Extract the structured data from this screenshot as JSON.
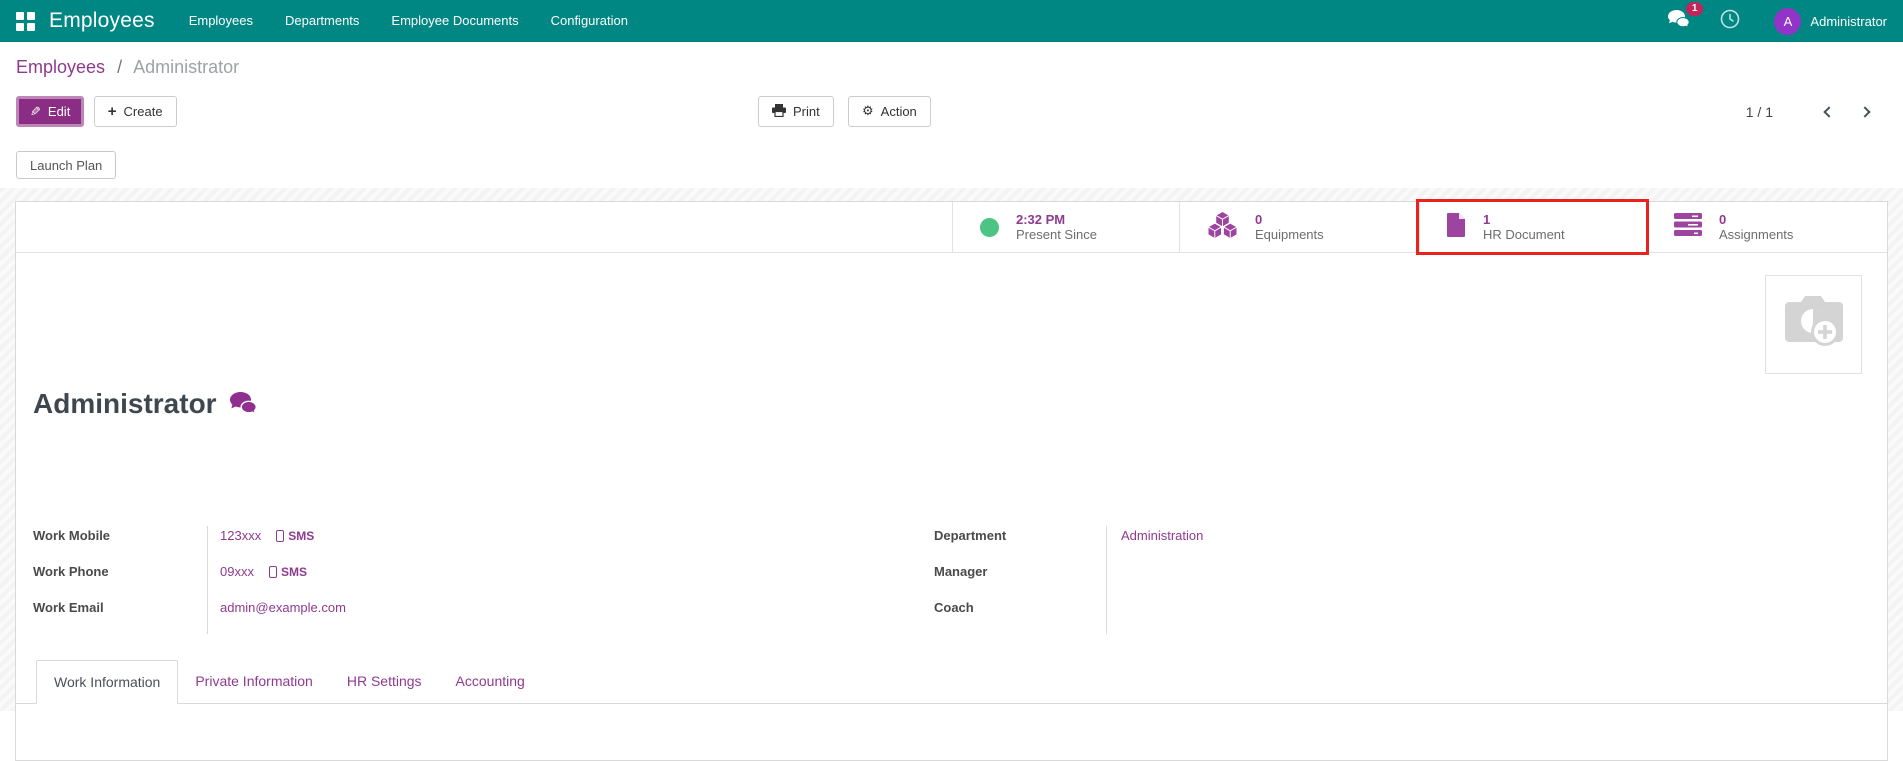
{
  "nav": {
    "brand": "Employees",
    "menu": [
      {
        "label": "Employees"
      },
      {
        "label": "Departments"
      },
      {
        "label": "Employee Documents"
      },
      {
        "label": "Configuration"
      }
    ],
    "messages_badge": "1",
    "user": {
      "initial": "A",
      "name": "Administrator"
    }
  },
  "breadcrumb": {
    "parent": "Employees",
    "separator": "/",
    "current": "Administrator"
  },
  "toolbar": {
    "edit": "Edit",
    "create": "Create",
    "print": "Print",
    "action": "Action",
    "pager": "1 / 1"
  },
  "buttons": {
    "launch_plan": "Launch Plan"
  },
  "stats": [
    {
      "value": "2:32 PM",
      "label": "Present Since",
      "icon": "presence-dot",
      "highlighted": false
    },
    {
      "value": "0",
      "label": "Equipments",
      "icon": "cubes",
      "highlighted": false
    },
    {
      "value": "1",
      "label": "HR Document",
      "icon": "file",
      "highlighted": true
    },
    {
      "value": "0",
      "label": "Assignments",
      "icon": "tasks",
      "highlighted": false
    }
  ],
  "employee": {
    "name": "Administrator",
    "left_fields": [
      {
        "label": "Work Mobile",
        "value": "123xxx",
        "action": "SMS"
      },
      {
        "label": "Work Phone",
        "value": "09xxx",
        "action": "SMS"
      },
      {
        "label": "Work Email",
        "value": "admin@example.com"
      }
    ],
    "right_fields": [
      {
        "label": "Department",
        "value": "Administration"
      },
      {
        "label": "Manager",
        "value": ""
      },
      {
        "label": "Coach",
        "value": ""
      }
    ]
  },
  "tabs": [
    {
      "label": "Work Information"
    },
    {
      "label": "Private Information"
    },
    {
      "label": "HR Settings"
    },
    {
      "label": "Accounting"
    }
  ],
  "colors": {
    "navbar_teal": "#008784",
    "accent_purple": "#8f3a8f",
    "primary_button_purple": "#8b2d85",
    "badge_pink": "#c2255c",
    "avatar_purple": "#9234c8",
    "presence_green": "#4ec484",
    "highlight_red": "#e8231d"
  }
}
